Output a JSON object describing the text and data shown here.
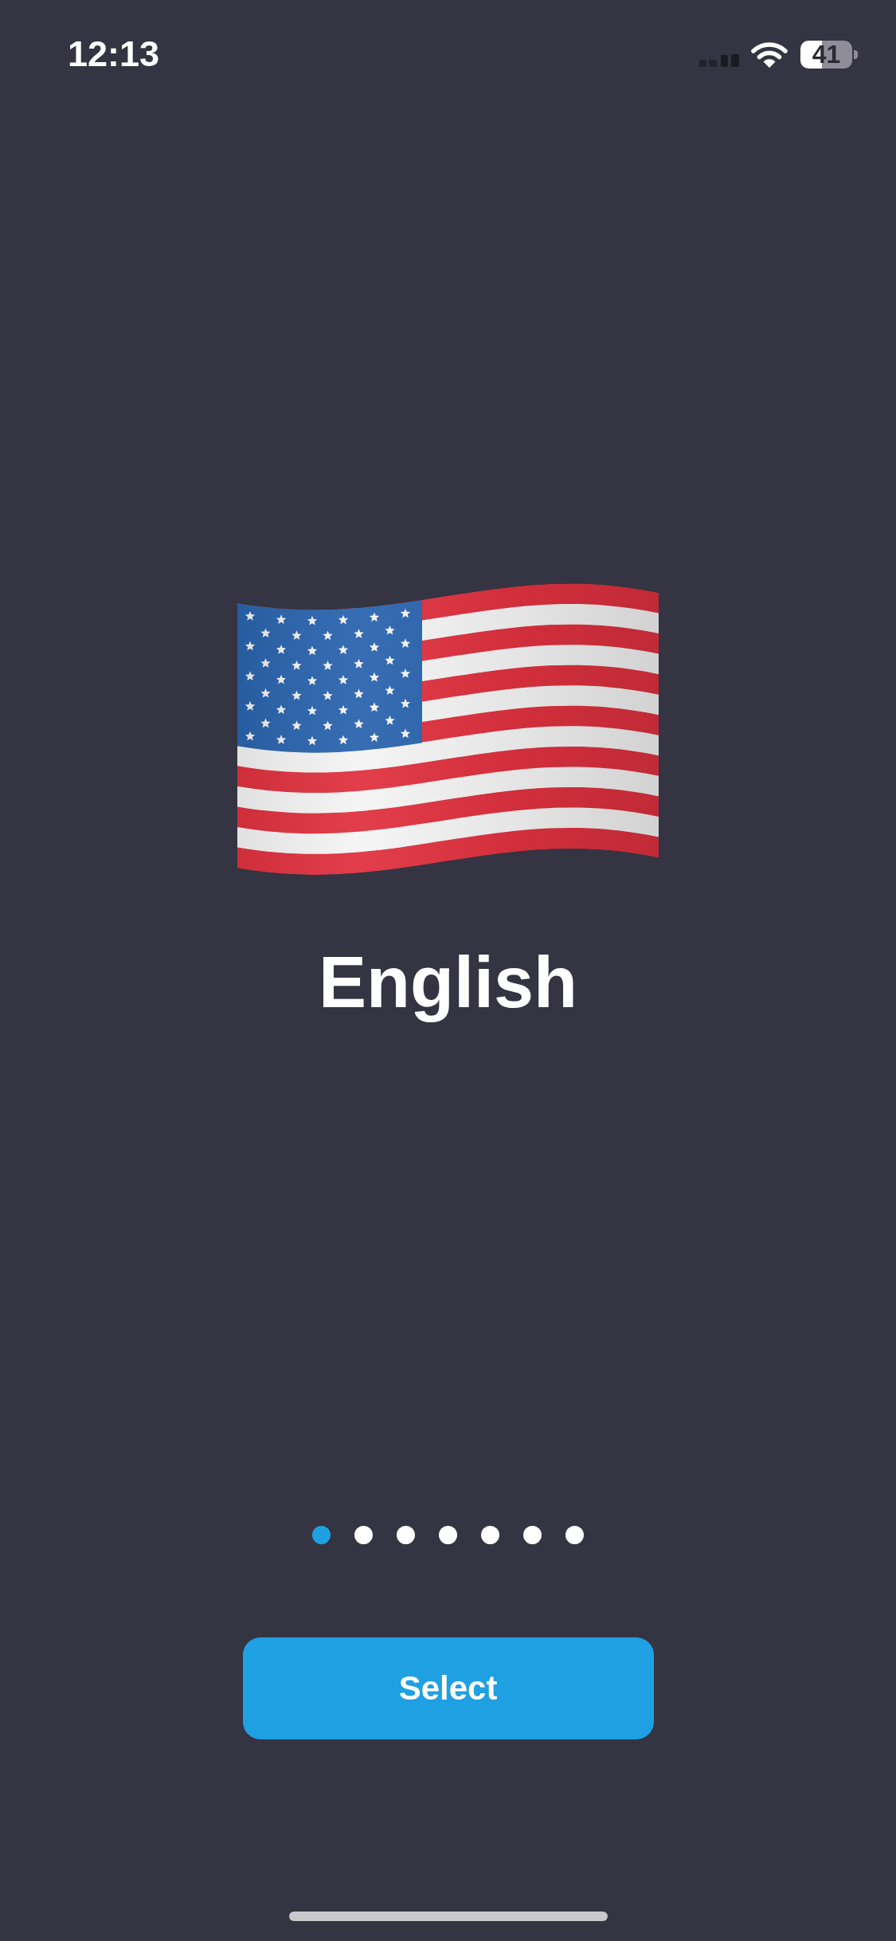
{
  "status_bar": {
    "time": "12:13",
    "battery": "41"
  },
  "language": {
    "name": "English"
  },
  "page_indicator": {
    "dots": [
      {
        "selected": true
      },
      {
        "selected": false
      },
      {
        "selected": false
      },
      {
        "selected": false
      },
      {
        "selected": false
      },
      {
        "selected": false
      },
      {
        "selected": false
      }
    ]
  },
  "button": {
    "label": "Select"
  }
}
